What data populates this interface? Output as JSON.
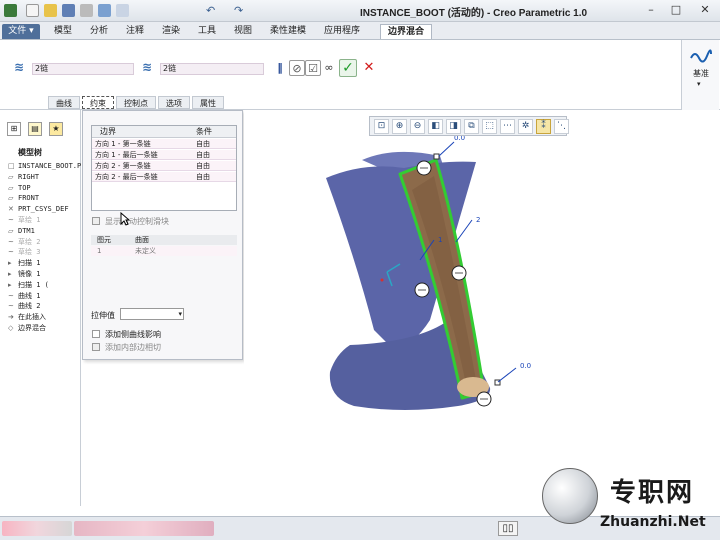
{
  "window": {
    "title": "INSTANCE_BOOT (活动的) - Creo Parametric 1.0"
  },
  "menu": {
    "tabs": [
      "文件",
      "模型",
      "分析",
      "注释",
      "渲染",
      "工具",
      "视图",
      "柔性建模",
      "应用程序",
      "边界混合"
    ],
    "file_arrow": "▾"
  },
  "dashboard": {
    "first_direction_value": "2链",
    "second_direction_value": "2链",
    "subtabs": [
      "曲线",
      "约束",
      "控制点",
      "选项",
      "属性"
    ],
    "datum_label": "基准"
  },
  "navigator": {
    "title": "模型树",
    "items": [
      {
        "label": "INSTANCE_BOOT.P",
        "icon": "□",
        "gray": false
      },
      {
        "label": "RIGHT",
        "icon": "▱",
        "gray": false
      },
      {
        "label": "TOP",
        "icon": "▱",
        "gray": false
      },
      {
        "label": "FRONT",
        "icon": "▱",
        "gray": false
      },
      {
        "label": "PRT_CSYS_DEF",
        "icon": "✕",
        "gray": false
      },
      {
        "label": "草绘 1",
        "icon": "~",
        "gray": true
      },
      {
        "label": "DTM1",
        "icon": "▱",
        "gray": false
      },
      {
        "label": "草绘 2",
        "icon": "~",
        "gray": true
      },
      {
        "label": "草绘 3",
        "icon": "~",
        "gray": true
      },
      {
        "label": "扫描 1",
        "icon": "▸",
        "gray": false
      },
      {
        "label": "镜像 1",
        "icon": "▸",
        "gray": false
      },
      {
        "label": "扫描 1 (",
        "icon": "▸",
        "gray": false
      },
      {
        "label": "曲线 1",
        "icon": "~",
        "gray": false
      },
      {
        "label": "曲线 2",
        "icon": "~",
        "gray": false
      },
      {
        "label": "在此插入",
        "icon": "➔",
        "gray": false
      },
      {
        "label": "边界混合",
        "icon": "◇",
        "gray": false
      }
    ]
  },
  "constraints": {
    "headers": {
      "boundary": "边界",
      "condition": "条件"
    },
    "rows": [
      {
        "boundary": "方向 1 - 第一条链",
        "condition": "自由"
      },
      {
        "boundary": "方向 1 - 最后一条链",
        "condition": "自由"
      },
      {
        "boundary": "方向 2 - 第一条链",
        "condition": "自由"
      },
      {
        "boundary": "方向 2 - 最后一条链",
        "condition": "自由"
      }
    ],
    "show_handles_label": "显示拖动控制滑块",
    "table2_headers": {
      "element": "图元",
      "surface": "曲面"
    },
    "table2_row": {
      "index": "1",
      "value": "未定义"
    },
    "stretch_label": "拉伸值",
    "stretch_value": "",
    "add_side_curve_label": "添加侧曲线影响",
    "add_inner_edge_label": "添加内部边相切"
  },
  "graphics": {
    "labels": [
      "0.0",
      "2",
      "1",
      "0.0"
    ],
    "colors": {
      "surface": "#5b65a8",
      "surface_dark": "#3c4583",
      "blend_surface": "#8c6a4a",
      "highlight": "#33cc33",
      "dimension": "#1a44b8"
    }
  },
  "view_toolbar": {
    "icons": [
      "refit-icon",
      "zoom-in-icon",
      "zoom-out-icon",
      "repaint-icon",
      "display-style-icon",
      "saved-views-icon",
      "view-manager-icon",
      "datum-display-icon",
      "spin-center-icon",
      "annotation-display-icon",
      "selection-icon"
    ]
  },
  "watermark": {
    "text_cn": "专职网",
    "text_en": "Zhuanzhi.Net"
  }
}
